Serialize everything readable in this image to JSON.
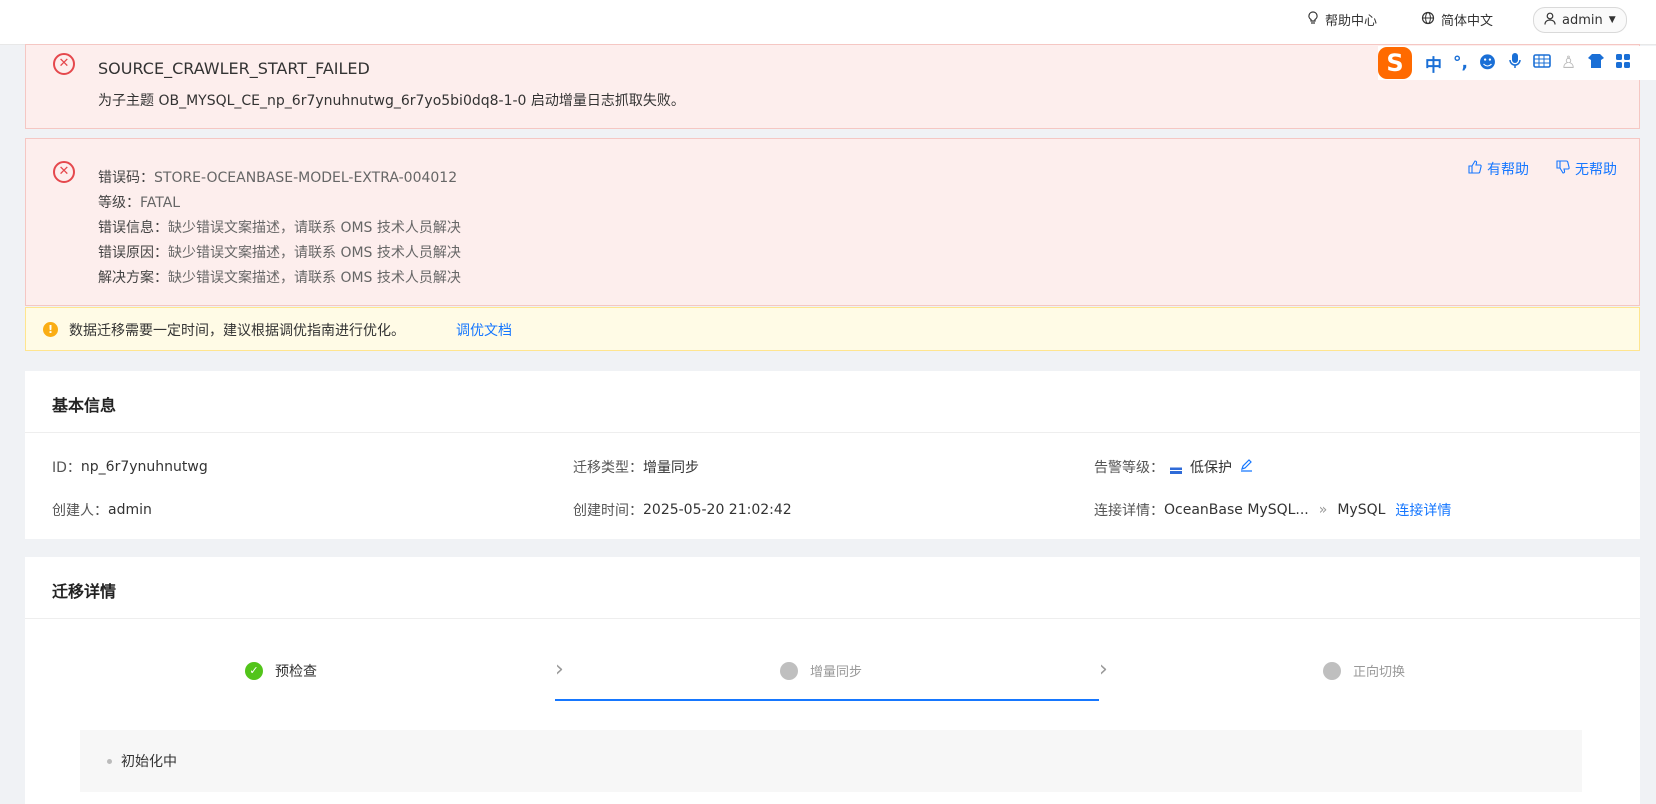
{
  "topbar": {
    "help_label": "帮助中心",
    "lang_label": "简体中文",
    "user_label": "admin"
  },
  "ime_toolbar": {
    "logo": "S",
    "mode": "中",
    "punct": "°,",
    "icons": [
      "emoji-icon",
      "mic-icon",
      "keyboard-icon",
      "user-icon",
      "skin-icon",
      "apps-icon"
    ]
  },
  "alert_error_1": {
    "title": "SOURCE_CRAWLER_START_FAILED",
    "description": "为子主题 OB_MYSQL_CE_np_6r7ynuhnutwg_6r7yo5bi0dq8-1-0 启动增量日志抓取失败。"
  },
  "alert_error_2": {
    "rows": [
      {
        "key": "错误码：",
        "value": "STORE-OCEANBASE-MODEL-EXTRA-004012"
      },
      {
        "key": "等级：",
        "value": "FATAL"
      },
      {
        "key": "错误信息：",
        "value": "缺少错误文案描述，请联系 OMS 技术人员解决"
      },
      {
        "key": "错误原因：",
        "value": "缺少错误文案描述，请联系 OMS 技术人员解决"
      },
      {
        "key": "解决方案：",
        "value": "缺少错误文案描述，请联系 OMS 技术人员解决"
      }
    ],
    "helpful_label": "有帮助",
    "unhelpful_label": "无帮助"
  },
  "alert_warning": {
    "message": "数据迁移需要一定时间，建议根据调优指南进行优化。",
    "link": "调优文档"
  },
  "basic_info": {
    "title": "基本信息",
    "id_key": "ID：",
    "id_value": "np_6r7ynuhnutwg",
    "type_key": "迁移类型：",
    "type_value": "增量同步",
    "alarm_key": "告警等级：",
    "alarm_value": "低保护",
    "creator_key": "创建人：",
    "creator_value": "admin",
    "created_key": "创建时间：",
    "created_value": "2025-05-20 21:02:42",
    "conn_key": "连接详情：",
    "conn_source": "OceanBase MySQL...",
    "conn_arrow": "»",
    "conn_target": "MySQL",
    "conn_link": "连接详情"
  },
  "migration_detail": {
    "title": "迁移详情",
    "steps": [
      {
        "label": "预检查",
        "status": "done"
      },
      {
        "label": "增量同步",
        "status": "active"
      },
      {
        "label": "正向切换",
        "status": "pending"
      }
    ],
    "status_text": "初始化中"
  }
}
